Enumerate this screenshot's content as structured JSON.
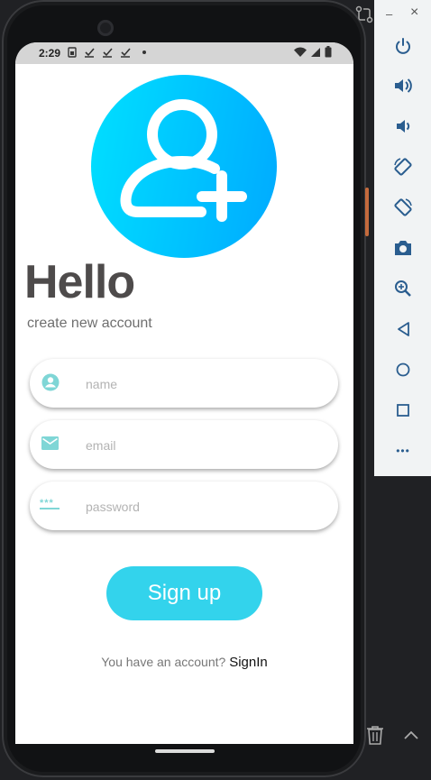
{
  "statusbar": {
    "time": "2:29",
    "notification_icons": [
      "sim-icon",
      "download-done-icon",
      "download-done-icon",
      "download-done-icon",
      "dot-icon"
    ],
    "system_icons": [
      "wifi-icon",
      "signal-icon",
      "battery-icon"
    ]
  },
  "app": {
    "avatar_icon": "add-user-icon",
    "title": "Hello",
    "subtitle": "create new account",
    "fields": {
      "name": {
        "placeholder": "name",
        "value": "",
        "icon": "person-icon"
      },
      "email": {
        "placeholder": "email",
        "value": "",
        "icon": "email-icon"
      },
      "password": {
        "placeholder": "password",
        "value": "",
        "icon": "password-icon",
        "icon_glyph": "***"
      }
    },
    "signup_label": "Sign up",
    "signin_prompt": "You have an account?",
    "signin_link": "SignIn"
  },
  "emulator_toolbar": {
    "window_controls": [
      "minimize-icon",
      "close-icon"
    ],
    "minimize_glyph": "–",
    "close_glyph": "×",
    "buttons": [
      "power-icon",
      "volume-up-icon",
      "volume-down-icon",
      "rotate-left-icon",
      "rotate-right-icon",
      "screenshot-icon",
      "zoom-icon",
      "back-icon",
      "home-icon",
      "overview-icon",
      "more-icon"
    ],
    "more_glyph": "•••",
    "bottom_buttons": [
      "trash-icon",
      "chevron-up-icon"
    ]
  },
  "colors": {
    "accent": "#33d3ec",
    "avatar_gradient_start": "#00e0ff",
    "avatar_gradient_end": "#00aaff",
    "title": "#4e4b4b",
    "field_icon": "#7fd6d6"
  }
}
